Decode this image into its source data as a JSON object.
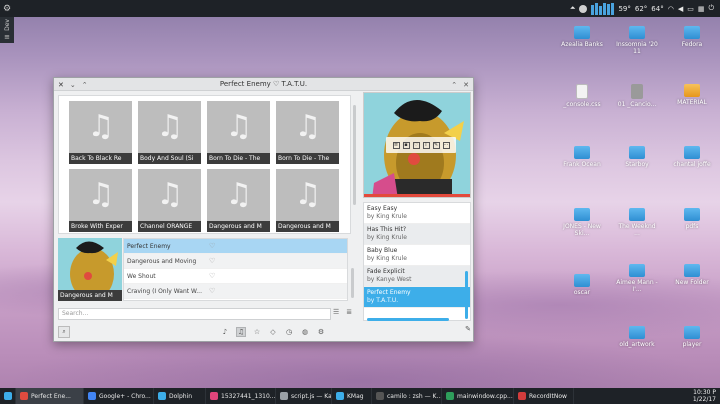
{
  "panel": {
    "menu_icon": "hamburger-menu-icon",
    "dev_label": "Dev",
    "tray": {
      "temp1": "59°",
      "temp2": "62°",
      "temp3": "64°"
    }
  },
  "desktop_icons": [
    {
      "label": "Azealia Banks",
      "type": "folder"
    },
    {
      "label": "Inssomnia '20 11",
      "type": "folder"
    },
    {
      "label": "Fedora",
      "type": "folder"
    },
    {
      "label": "_console.css",
      "type": "file"
    },
    {
      "label": "01 _Cancio...",
      "type": "audio"
    },
    {
      "label": "MATERIAL",
      "type": "folder-open"
    },
    {
      "label": "Frank Ocean",
      "type": "folder"
    },
    {
      "label": "Starboy",
      "type": "folder"
    },
    {
      "label": "chantal joffe",
      "type": "folder"
    },
    {
      "label": "JONES - New Ski...",
      "type": "folder"
    },
    {
      "label": "The Weeknd ...",
      "type": "folder"
    },
    {
      "label": "pdfs",
      "type": "folder"
    },
    {
      "label": "Aimee Mann - I'...",
      "type": "folder"
    },
    {
      "label": "New Folder",
      "type": "folder"
    },
    {
      "label": "oscar",
      "type": "folder"
    },
    {
      "label": "old_artwork",
      "type": "folder"
    },
    {
      "label": "player",
      "type": "folder"
    }
  ],
  "window": {
    "title": "Perfect Enemy ♡ T.A.T.U.",
    "albums": [
      {
        "title": "Back To Black Re"
      },
      {
        "title": "Body And Soul (Si"
      },
      {
        "title": "Born To Die - The"
      },
      {
        "title": "Born To Die - The"
      },
      {
        "title": "Broke With Exper"
      },
      {
        "title": "Channel ORANGE"
      },
      {
        "title": "Dangerous and M"
      },
      {
        "title": "Dangerous and M"
      }
    ],
    "current_album_caption": "Dangerous and M",
    "tracks": [
      {
        "name": "Perfect Enemy",
        "active": true
      },
      {
        "name": "Dangerous and Moving",
        "active": false
      },
      {
        "name": "We Shout",
        "active": false
      },
      {
        "name": "Craving (I Only Want W...",
        "active": false
      }
    ],
    "search_placeholder": "Search...",
    "playlist": [
      {
        "title": "Easy Easy",
        "artist": "by King Krule",
        "active": false
      },
      {
        "title": "Has This Hit?",
        "artist": "by King Krule",
        "active": false
      },
      {
        "title": "Baby Blue",
        "artist": "by King Krule",
        "active": false
      },
      {
        "title": "Fade Explicit",
        "artist": "by Kanye West",
        "active": false
      },
      {
        "title": "Perfect Enemy",
        "artist": "by T.A.T.U.",
        "active": true
      }
    ]
  },
  "taskbar": {
    "items": [
      {
        "label": "Perfect Ene...",
        "active": true,
        "color": "#e04b3f"
      },
      {
        "label": "Google+ - Chro...",
        "active": false,
        "color": "#4285f4"
      },
      {
        "label": "Dolphin",
        "active": false,
        "color": "#3daee9"
      },
      {
        "label": "15327441_1310...",
        "active": false,
        "color": "#e0457b"
      },
      {
        "label": "script.js — Kate",
        "active": false,
        "color": "#9aa0a6"
      },
      {
        "label": "KMag",
        "active": false,
        "color": "#3daee9"
      },
      {
        "label": "camilo : zsh — K...",
        "active": false,
        "color": "#555555"
      },
      {
        "label": "mainwindow.cpp...",
        "active": false,
        "color": "#2e9e5b"
      },
      {
        "label": "RecordItNow",
        "active": false,
        "color": "#d23c3c"
      }
    ],
    "clock_time": "10:30 P",
    "clock_date": "1/22/17"
  }
}
